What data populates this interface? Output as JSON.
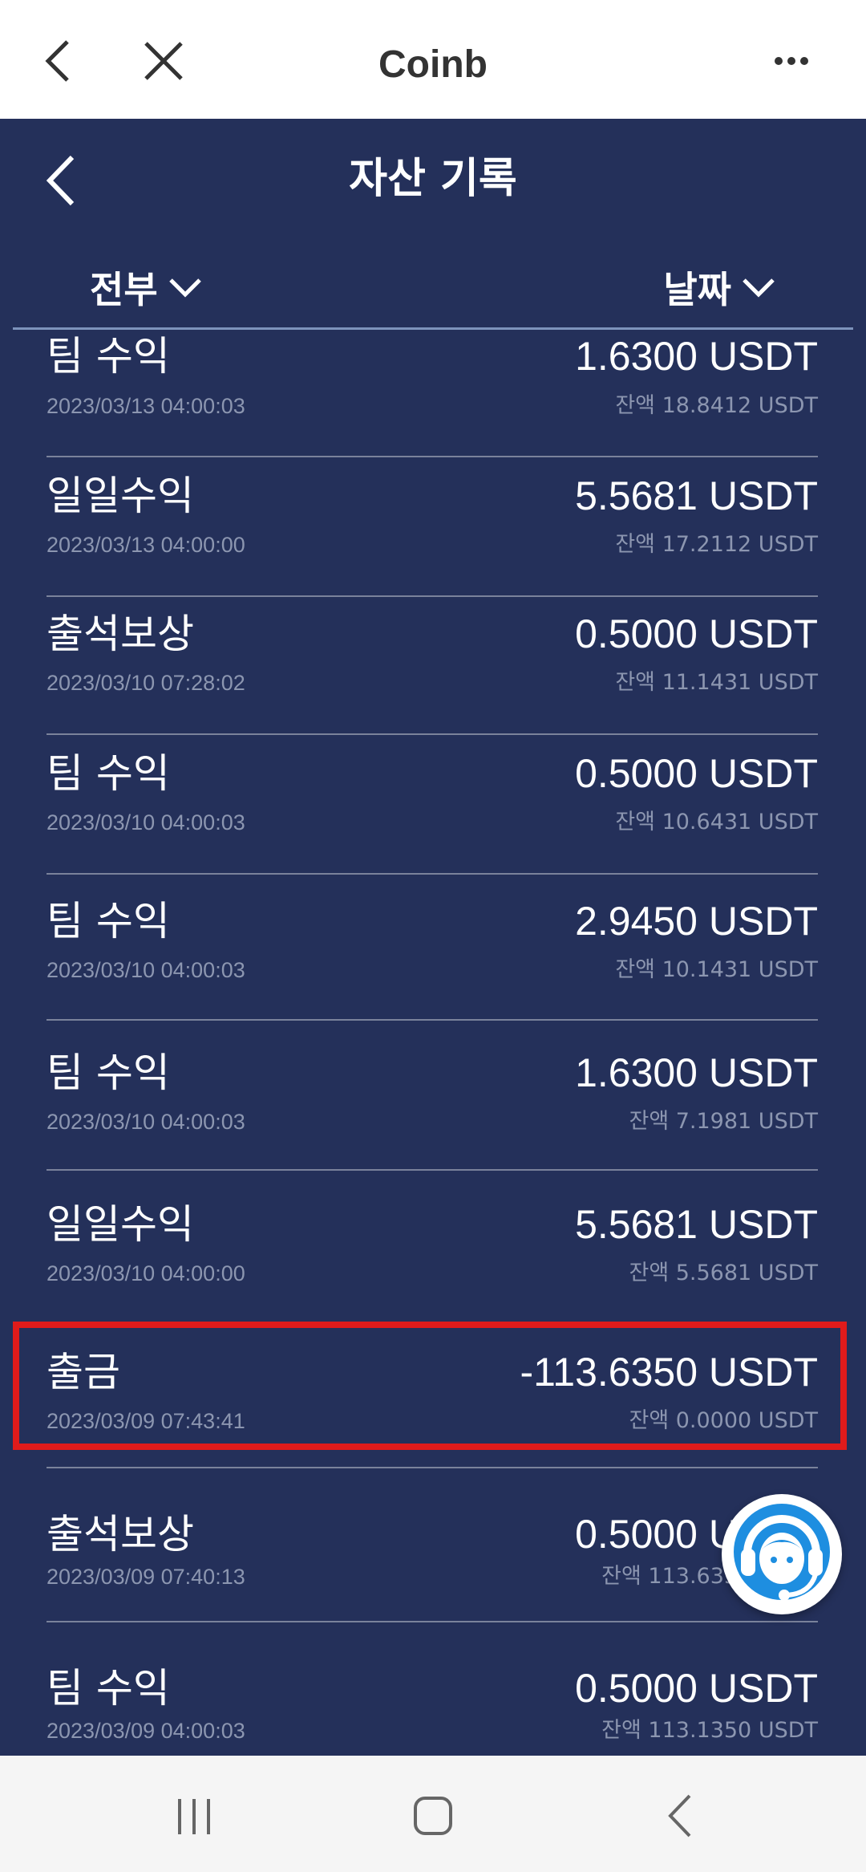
{
  "browser": {
    "title": "Coinb"
  },
  "header": {
    "title": "자산 기록"
  },
  "filters": {
    "type_label": "전부",
    "sort_label": "날짜"
  },
  "records": [
    {
      "label": "팀 수익",
      "amount": "1.6300 USDT",
      "datetime": "2023/03/13 04:00:03",
      "balance": "잔액 18.8412 USDT"
    },
    {
      "label": "일일수익",
      "amount": "5.5681 USDT",
      "datetime": "2023/03/13 04:00:00",
      "balance": "잔액 17.2112 USDT"
    },
    {
      "label": "출석보상",
      "amount": "0.5000 USDT",
      "datetime": "2023/03/10 07:28:02",
      "balance": "잔액 11.1431 USDT"
    },
    {
      "label": "팀 수익",
      "amount": "0.5000 USDT",
      "datetime": "2023/03/10 04:00:03",
      "balance": "잔액 10.6431 USDT"
    },
    {
      "label": "팀 수익",
      "amount": "2.9450 USDT",
      "datetime": "2023/03/10 04:00:03",
      "balance": "잔액 10.1431 USDT"
    },
    {
      "label": "팀 수익",
      "amount": "1.6300 USDT",
      "datetime": "2023/03/10 04:00:03",
      "balance": "잔액 7.1981 USDT"
    },
    {
      "label": "일일수익",
      "amount": "5.5681 USDT",
      "datetime": "2023/03/10 04:00:00",
      "balance": "잔액 5.5681 USDT"
    },
    {
      "label": "출금",
      "amount": "-113.6350 USDT",
      "datetime": "2023/03/09 07:43:41",
      "balance": "잔액 0.0000 USDT"
    },
    {
      "label": "출석보상",
      "amount": "0.5000 USDT",
      "datetime": "2023/03/09 07:40:13",
      "balance": "잔액 113.6350 USDT"
    },
    {
      "label": "팀 수익",
      "amount": "0.5000 USDT",
      "datetime": "2023/03/09 04:00:03",
      "balance": "잔액 113.1350 USDT"
    }
  ],
  "icons": {
    "browser_back": "chevron-left-icon",
    "browser_close": "close-icon",
    "browser_more": "more-icon",
    "support": "headset-icon"
  },
  "colors": {
    "background": "#24305a",
    "highlight": "#e01b1b",
    "support_icon": "#1e8ee0"
  }
}
